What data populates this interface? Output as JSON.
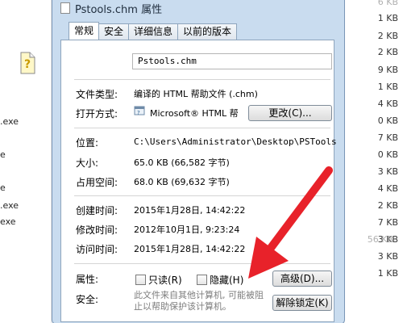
{
  "window": {
    "title": "Pstools.chm 属性"
  },
  "tabs": [
    {
      "label": "常规",
      "active": true
    },
    {
      "label": "安全",
      "active": false
    },
    {
      "label": "详细信息",
      "active": false
    },
    {
      "label": "以前的版本",
      "active": false
    }
  ],
  "file": {
    "name": "Pstools.chm"
  },
  "props": {
    "type_label": "文件类型:",
    "type_value": "编译的 HTML 帮助文件 (.chm)",
    "open_label": "打开方式:",
    "open_value": "Microsoft® HTML 帮",
    "change_button": "更改(C)...",
    "location_label": "位置:",
    "location_value": "C:\\Users\\Administrator\\Desktop\\PSTools",
    "size_label": "大小:",
    "size_value": "65.0 KB (66,582 字节)",
    "disk_label": "占用空间:",
    "disk_value": "68.0 KB (69,632 字节)",
    "created_label": "创建时间:",
    "created_value": "2015年1月28日, 14:42:22",
    "modified_label": "修改时间:",
    "modified_value": "2012年10月1日, 9:23:24",
    "accessed_label": "访问时间:",
    "accessed_value": "2015年1月28日, 14:42:22",
    "attributes_label": "属性:",
    "readonly_label": "只读(R)",
    "hidden_label": "隐藏(H)",
    "advanced_button": "高级(D)...",
    "security_label": "安全:",
    "security_text": "此文件来自其他计算机, 可能被阻止以帮助保护该计算机。",
    "unblock_button": "解除锁定(K)"
  },
  "background": {
    "left_files": [
      ".exe",
      "e",
      "e",
      ".exe",
      "exe"
    ],
    "right_sizes": [
      "6 KB",
      "1 KB",
      "2 KB",
      "2 KB",
      "9 KB",
      "1 KB",
      "4 KB",
      "0 KB",
      "7 KB",
      "0 KB",
      "3 KB",
      "4 KB",
      "2 KB",
      "7 KB",
      "3 KB",
      "56 KB",
      "3 KB",
      "1 KB"
    ]
  },
  "colors": {
    "arrow": "#e8222a",
    "dialog_frame": "#c9dcef"
  }
}
